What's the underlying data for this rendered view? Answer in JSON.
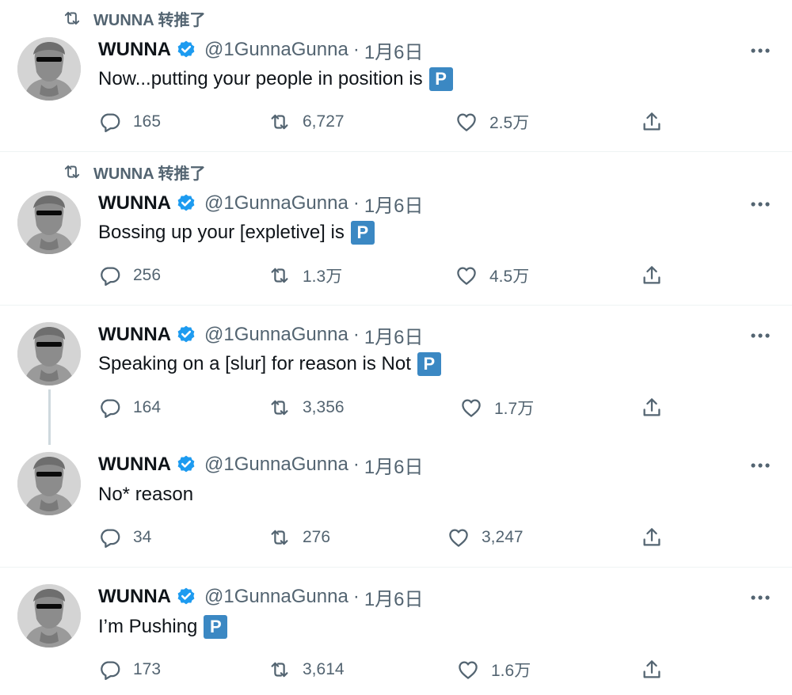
{
  "retweet_label": "WUNNA 转推了",
  "tweets": [
    {
      "name": "WUNNA",
      "handle": "@1GunnaGunna",
      "separator": "·",
      "date": "1月6日",
      "text": "Now...putting your people in position is",
      "p_badge": "P",
      "replies": "165",
      "retweets": "6,727",
      "likes": "2.5万"
    },
    {
      "name": "WUNNA",
      "handle": "@1GunnaGunna",
      "separator": "·",
      "date": "1月6日",
      "text": "Bossing up your [expletive] is",
      "p_badge": "P",
      "replies": "256",
      "retweets": "1.3万",
      "likes": "4.5万"
    },
    {
      "name": "WUNNA",
      "handle": "@1GunnaGunna",
      "separator": "·",
      "date": "1月6日",
      "text": "Speaking on a [slur] for reason is Not",
      "p_badge": "P",
      "replies": "164",
      "retweets": "3,356",
      "likes": "1.7万"
    },
    {
      "name": "WUNNA",
      "handle": "@1GunnaGunna",
      "separator": "·",
      "date": "1月6日",
      "text": "No* reason",
      "p_badge": "",
      "replies": "34",
      "retweets": "276",
      "likes": "3,247"
    },
    {
      "name": "WUNNA",
      "handle": "@1GunnaGunna",
      "separator": "·",
      "date": "1月6日",
      "text": "I’m Pushing",
      "p_badge": "P",
      "replies": "173",
      "retweets": "3,614",
      "likes": "1.6万"
    }
  ],
  "icons": {
    "retweet_label": "retweet-icon",
    "verified": "verified-badge-icon",
    "more": "more-icon",
    "reply": "reply-icon",
    "retweet": "retweet-icon",
    "like": "like-icon",
    "share": "share-icon"
  },
  "colors": {
    "text": "#0f1419",
    "secondary": "#536471",
    "verified": "#1d9bf0",
    "p_badge": "#3b88c3",
    "divider": "#eff3f4",
    "thread_line": "#cfd9de"
  }
}
